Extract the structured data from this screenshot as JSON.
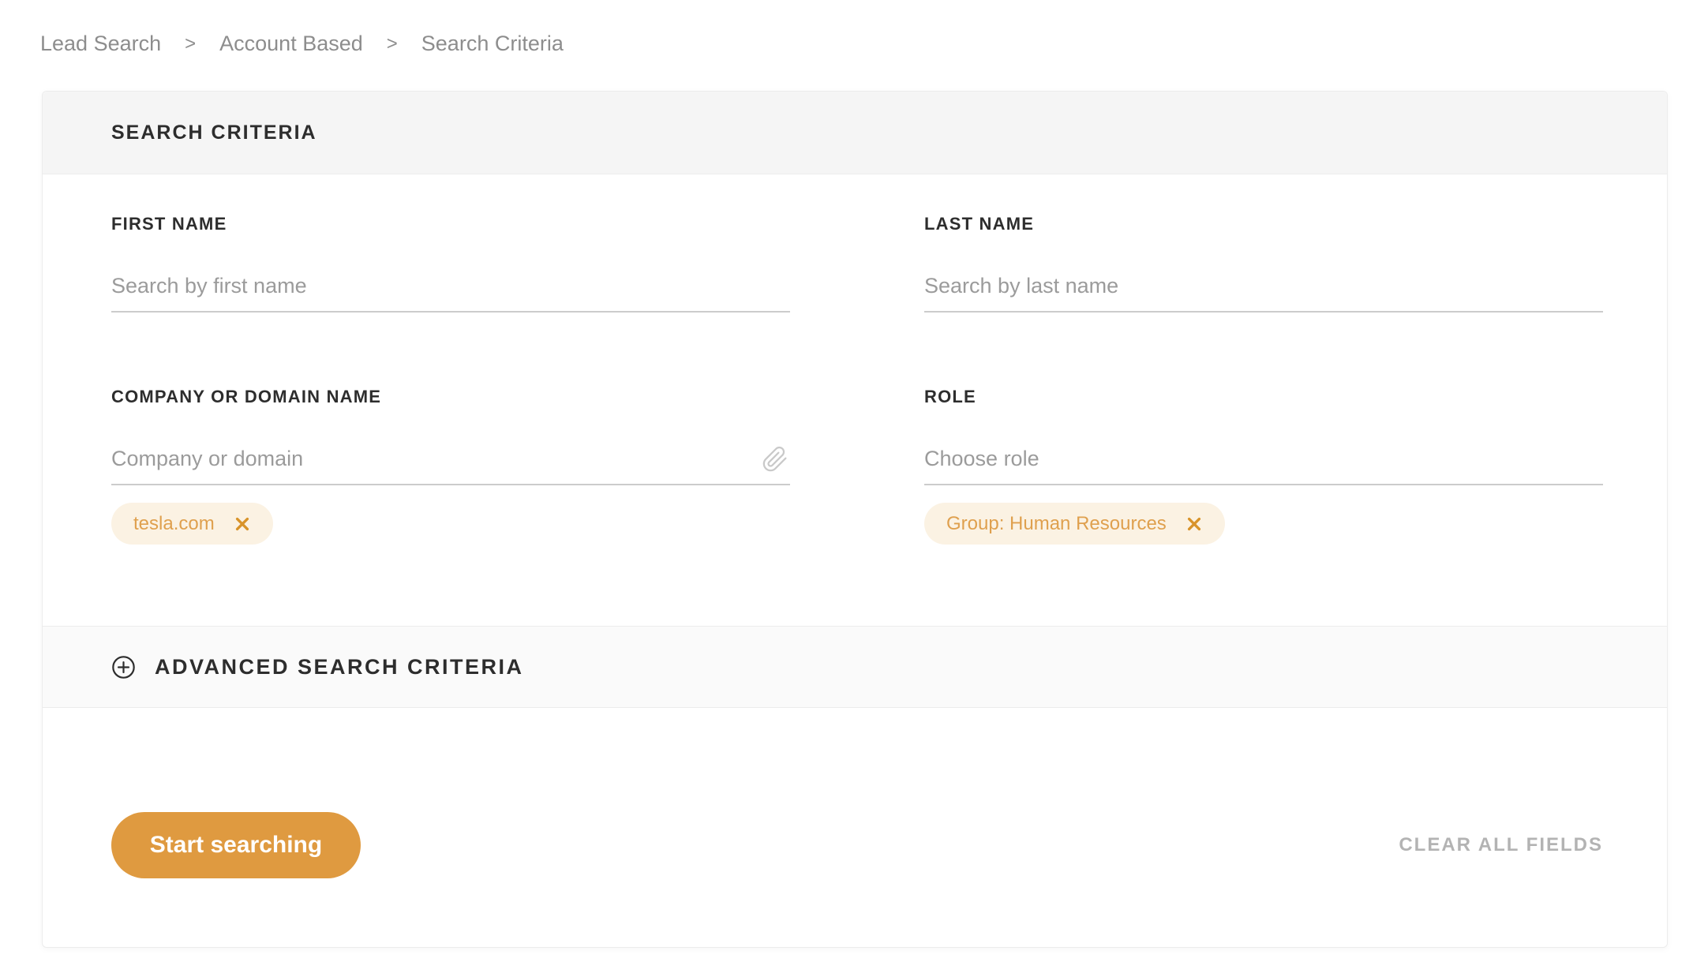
{
  "breadcrumb": {
    "separator": ">",
    "items": [
      {
        "label": "Lead Search"
      },
      {
        "label": "Account Based"
      },
      {
        "label": "Search Criteria"
      }
    ]
  },
  "card": {
    "header": {
      "title": "SEARCH CRITERIA"
    },
    "fields": {
      "first_name": {
        "label": "FIRST NAME",
        "placeholder": "Search by first name",
        "value": ""
      },
      "last_name": {
        "label": "LAST NAME",
        "placeholder": "Search by last name",
        "value": ""
      },
      "company": {
        "label": "COMPANY OR DOMAIN NAME",
        "placeholder": "Company or domain",
        "value": "",
        "attachment_icon": "paperclip-icon",
        "tags": [
          {
            "label": "tesla.com"
          }
        ]
      },
      "role": {
        "label": "ROLE",
        "placeholder": "Choose role",
        "value": "",
        "tags": [
          {
            "label": "Group: Human Resources"
          }
        ]
      }
    },
    "advanced": {
      "label": "ADVANCED SEARCH CRITERIA",
      "icon": "plus-circle-icon"
    },
    "footer": {
      "search_button": "Start searching",
      "clear_button": "CLEAR ALL FIELDS"
    }
  },
  "colors": {
    "accent_orange": "#DF9A40",
    "tag_bg": "#FBF2E3",
    "tag_text": "#DFA04E",
    "tag_close": "#D89329",
    "header_bg": "#F5F5F5",
    "advanced_bg": "#FAFAFA",
    "border": "#ECECEC",
    "underline": "#CCCCCC",
    "label_text": "#2D2D2D",
    "placeholder_text": "#9B9B9B",
    "breadcrumb_text": "#8D8D8D",
    "clear_text": "#B3B3B3"
  }
}
